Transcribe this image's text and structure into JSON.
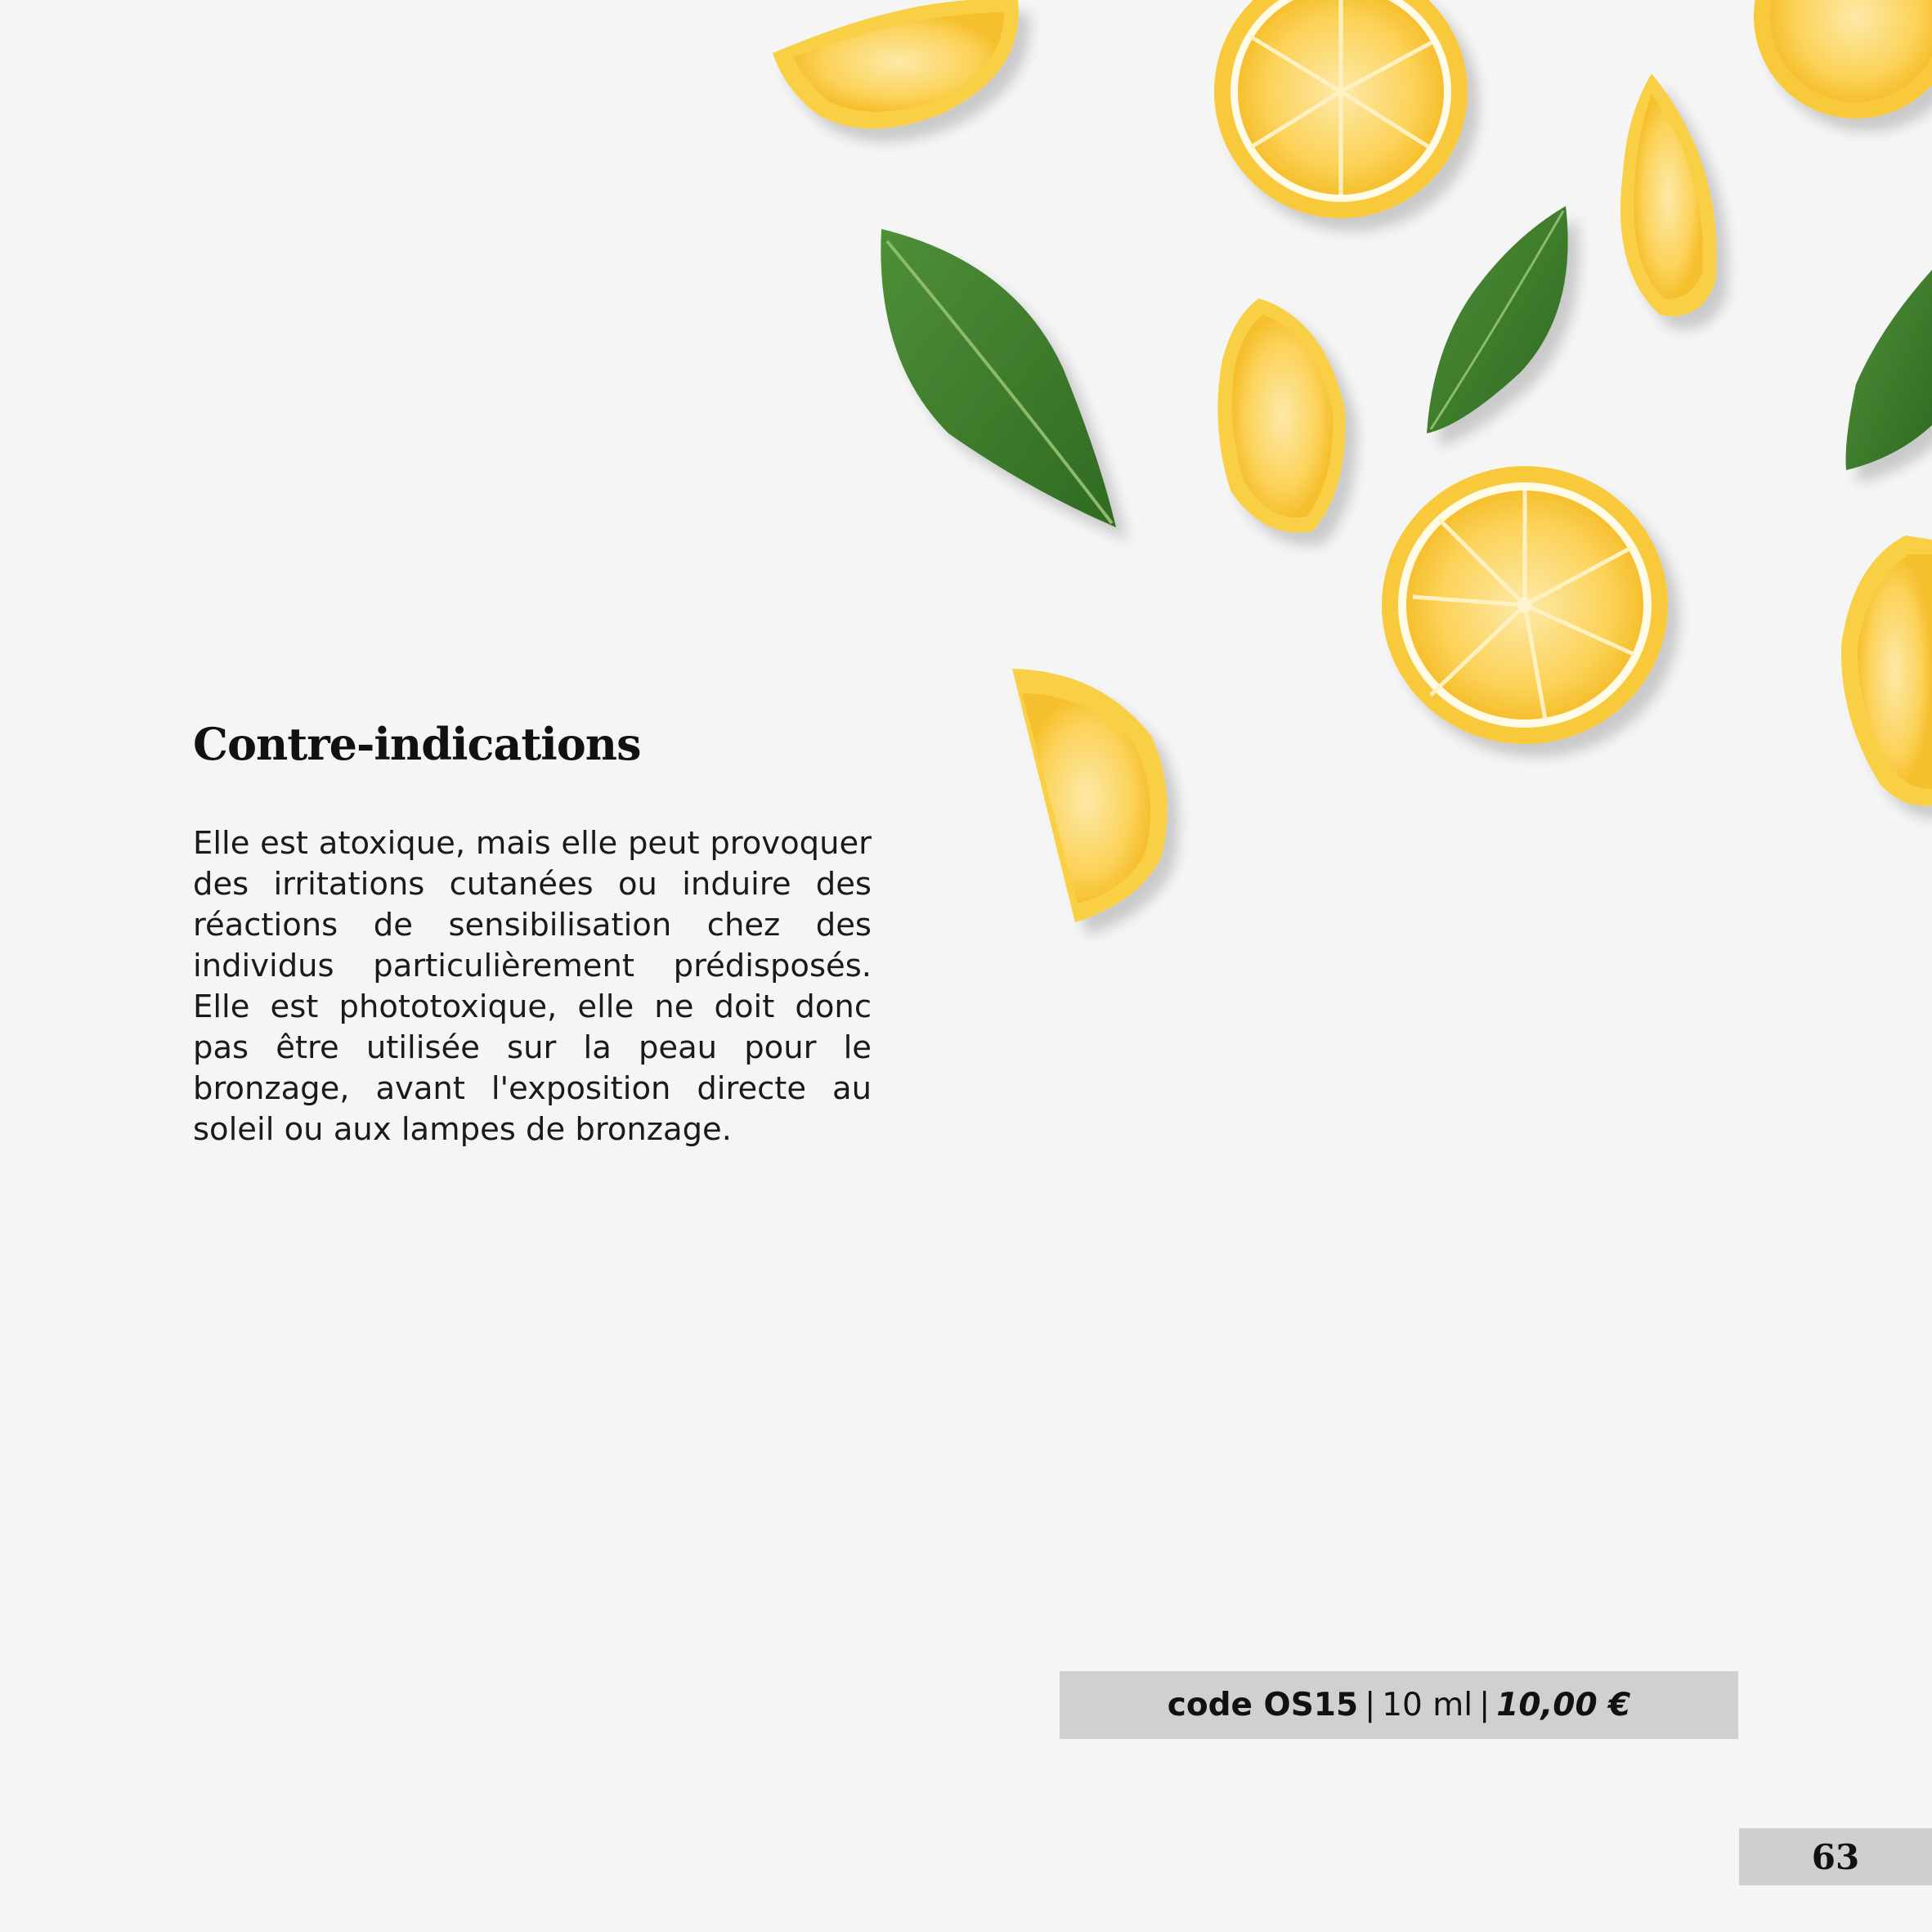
{
  "section": {
    "title": "Contre-indications",
    "body": "Elle est atoxique, mais elle peut provoquer des irritations cutanées ou induire des réactions de sensibilisation chez des individus particulièrement prédisposés. Elle est phototoxique, elle ne doit donc pas être utilisée sur la peau pour le bronzage, avant l'exposition directe au soleil ou aux lampes de bronzage."
  },
  "product": {
    "code": "code OS15",
    "separator": "|",
    "volume": "10 ml",
    "price": "10,00 €"
  },
  "page_number": "63",
  "colors": {
    "background": "#f5f5f5",
    "bar": "#d0d0d0",
    "lemon_peel": "#f7c93a",
    "lemon_flesh": "#fcd45c",
    "leaf": "#3f7d2e"
  }
}
